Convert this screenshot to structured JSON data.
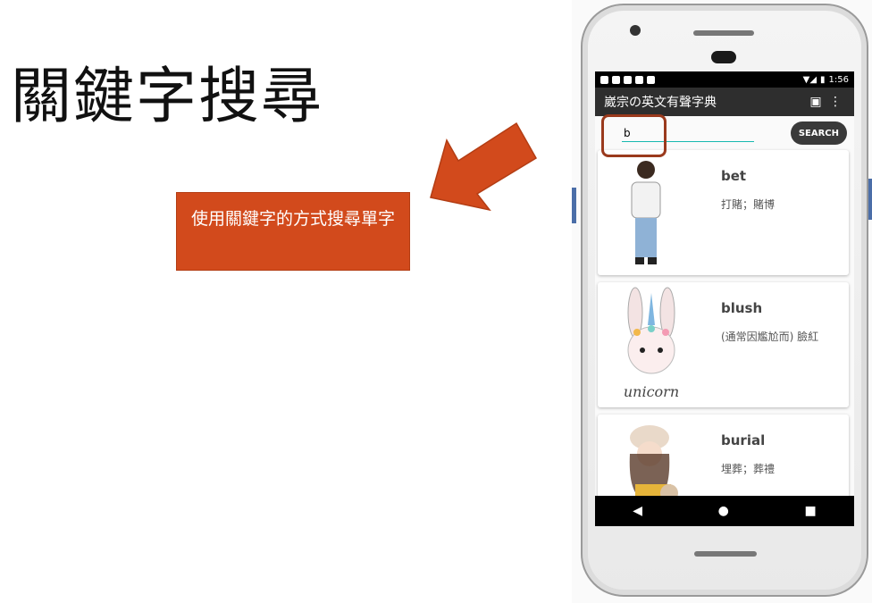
{
  "slide": {
    "title": "關鍵字搜尋",
    "callout": "使用關鍵字的方式搜尋單字",
    "accent_color": "#d24a1c"
  },
  "status_bar": {
    "time": "1:56"
  },
  "app_bar": {
    "title": "崴宗の英文有聲字典",
    "calendar_icon": "calendar-icon",
    "menu_icon": "more-vert-icon"
  },
  "search": {
    "value": "b",
    "button_label": "SEARCH"
  },
  "results": [
    {
      "word": "bet",
      "meaning": "打賭；賭博"
    },
    {
      "word": "blush",
      "meaning": "(通常因尷尬而) 臉紅",
      "image_text": "unicorn"
    },
    {
      "word": "burial",
      "meaning": "埋葬；葬禮"
    }
  ],
  "nav": {
    "back": "◀",
    "home": "●",
    "recents": "■"
  }
}
